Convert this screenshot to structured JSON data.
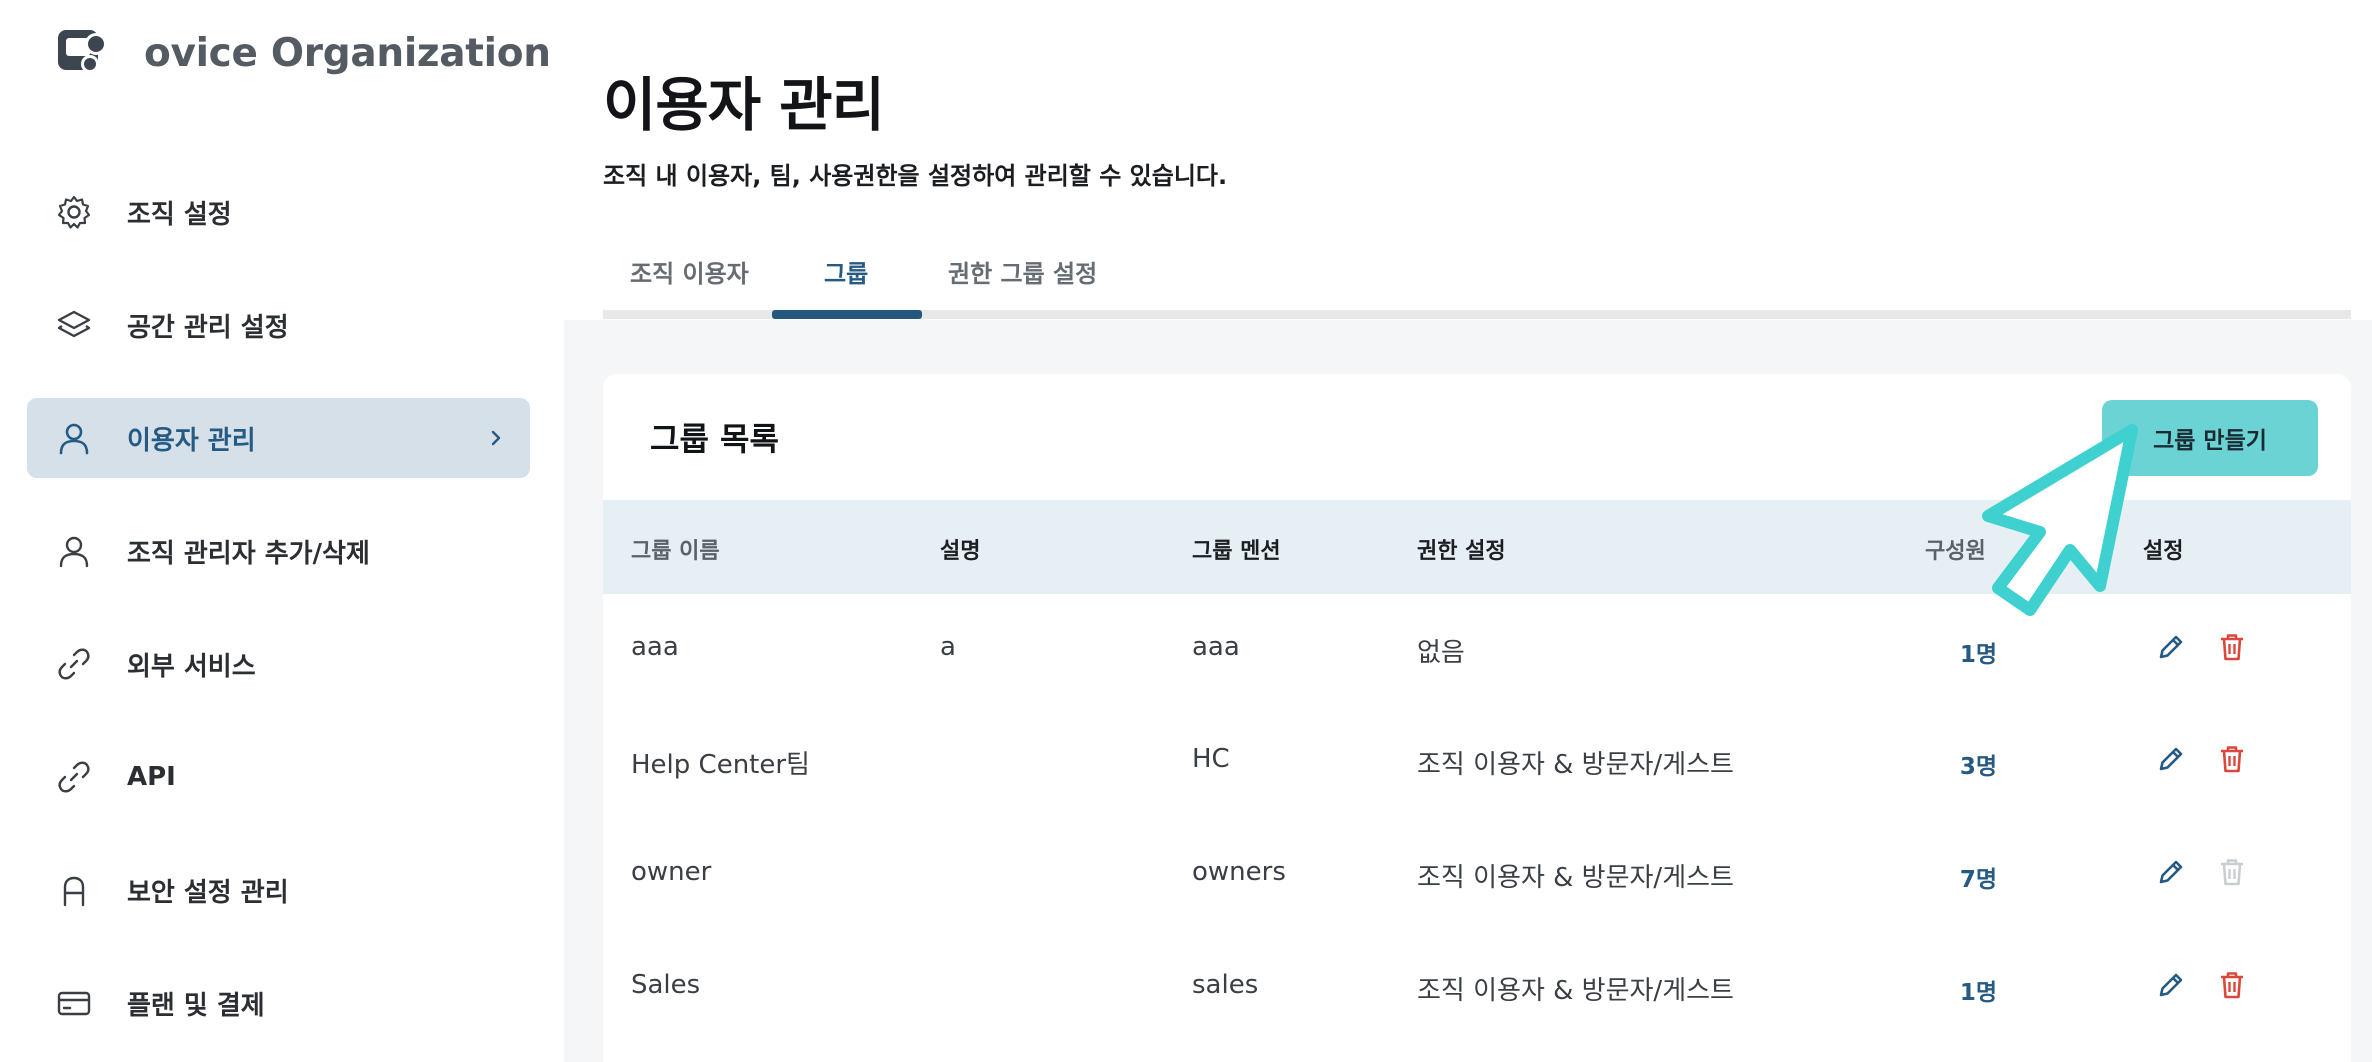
{
  "org": {
    "name": "ovice Organization"
  },
  "sidebar": {
    "items": [
      {
        "label": "조직 설정",
        "icon": "gear-icon"
      },
      {
        "label": "공간 관리 설정",
        "icon": "layers-icon"
      },
      {
        "label": "이용자 관리",
        "icon": "user-icon",
        "active": true
      },
      {
        "label": "조직 관리자 추가/삭제",
        "icon": "user-icon"
      },
      {
        "label": "외부 서비스",
        "icon": "link-icon"
      },
      {
        "label": "API",
        "icon": "link-icon"
      },
      {
        "label": "보안 설정 관리",
        "icon": "lock-icon"
      },
      {
        "label": "플랜 및 결제",
        "icon": "card-icon"
      }
    ]
  },
  "page": {
    "title": "이용자 관리",
    "description": "조직 내 이용자, 팀, 사용권한을 설정하여 관리할 수 있습니다."
  },
  "tabs": [
    {
      "label": "조직 이용자"
    },
    {
      "label": "그룹",
      "active": true
    },
    {
      "label": "권한 그룹 설정"
    }
  ],
  "group_list": {
    "title": "그룹 목록",
    "create_button": "그룹 만들기",
    "columns": {
      "name": "그룹 이름",
      "description": "설명",
      "mention": "그룹 멘션",
      "permission": "권한 설정",
      "members": "구성원",
      "settings": "설정"
    },
    "rows": [
      {
        "name": "aaa",
        "description": "a",
        "mention": "aaa",
        "permission": "없음",
        "members": "1명",
        "deletable": true
      },
      {
        "name": "Help Center팀",
        "description": "",
        "mention": "HC",
        "permission": "조직 이용자 & 방문자/게스트",
        "members": "3명",
        "deletable": true
      },
      {
        "name": "owner",
        "description": "",
        "mention": "owners",
        "permission": "조직 이용자 & 방문자/게스트",
        "members": "7명",
        "deletable": false
      },
      {
        "name": "Sales",
        "description": "",
        "mention": "sales",
        "permission": "조직 이용자 & 방문자/게스트",
        "members": "1명",
        "deletable": true
      }
    ]
  },
  "colors": {
    "accent": "#255a84",
    "button": "#6bd3d3",
    "delete": "#d9483b",
    "delete_disabled": "#c9ced3",
    "cursor": "#3fd0d0"
  }
}
